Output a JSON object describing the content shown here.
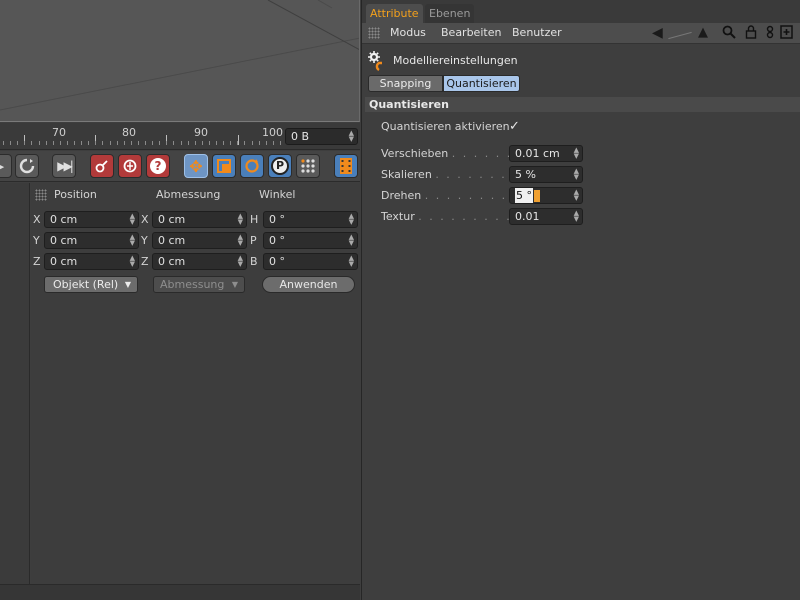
{
  "timeline": {
    "ticks": [
      "70",
      "80",
      "90",
      "100"
    ],
    "frame_value": "0 B"
  },
  "coords": {
    "headers": {
      "position": "Position",
      "size": "Abmessung",
      "rotation": "Winkel"
    },
    "rows": [
      {
        "pos_axis": "X",
        "pos": "0 cm",
        "size_axis": "X",
        "size": "0 cm",
        "rot_axis": "H",
        "rot": "0 °"
      },
      {
        "pos_axis": "Y",
        "pos": "0 cm",
        "size_axis": "Y",
        "size": "0 cm",
        "rot_axis": "P",
        "rot": "0 °"
      },
      {
        "pos_axis": "Z",
        "pos": "0 cm",
        "size_axis": "Z",
        "size": "0 cm",
        "rot_axis": "B",
        "rot": "0 °"
      }
    ],
    "mode_select": "Objekt (Rel)",
    "size_select": "Abmessung",
    "apply_label": "Anwenden"
  },
  "attributes": {
    "tabs": [
      "Attribute",
      "Ebenen"
    ],
    "menu": [
      "Modus",
      "Bearbeiten",
      "Benutzer"
    ],
    "object_name": "Modelliereinstellungen",
    "subtabs": [
      "Snapping",
      "Quantisieren"
    ],
    "section_title": "Quantisieren",
    "enable_label": "Quantisieren aktivieren",
    "enable_check": "✓",
    "fields": [
      {
        "label": "Verschieben",
        "dots": ". . . . . . . . .",
        "value": "0.01 cm"
      },
      {
        "label": "Skalieren",
        "dots": ". . . . . . . . . . . .",
        "value": "5 %"
      },
      {
        "label": "Drehen",
        "dots": ". . . . . . . . . . . . . .",
        "value": "5 °"
      },
      {
        "label": "Textur",
        "dots": ". . . . . . . . . . . . . . .",
        "value": "0.01"
      }
    ]
  },
  "colors": {
    "accent_tab": "#f4a11c",
    "selected_tab": "#a9c6ea",
    "panel_bg": "#3e3e3e"
  },
  "icons": {
    "left_tools": [
      "play-icon",
      "loop-icon",
      "skip-end-icon",
      "record-keys-icon",
      "autokey-icon",
      "help-icon",
      "move-icon",
      "scale-icon",
      "rotate-icon",
      "parameter-icon",
      "grid-dots-icon",
      "film-icon"
    ],
    "right_tools": [
      "back-arrow-icon",
      "pointer-icon",
      "search-icon",
      "lock-icon",
      "link-icon",
      "add-panel-icon"
    ]
  }
}
